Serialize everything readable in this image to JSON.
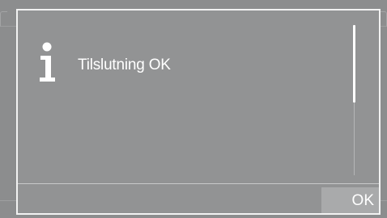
{
  "dialog": {
    "icon": "info-icon",
    "message": "Tilslutning OK",
    "ok_label": "OK"
  },
  "colors": {
    "background": "#8c8d8e",
    "dialog_background": "#929394",
    "border": "#f2f2f2",
    "text": "#ffffff",
    "button_background": "#a9aaab"
  }
}
